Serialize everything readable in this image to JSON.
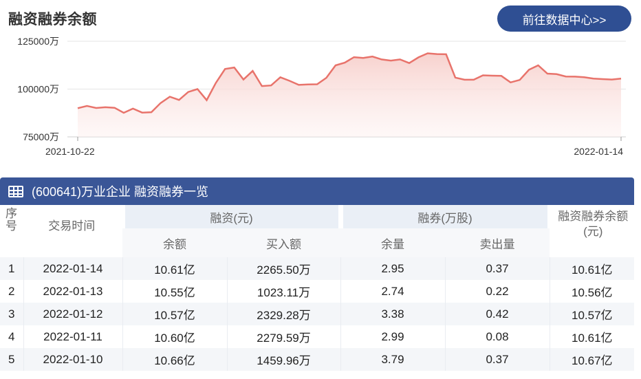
{
  "title": "融资融券余额",
  "more_button": "前往数据中心>>",
  "colors": {
    "line": "#e8736b",
    "area_top": "#f7cfcb",
    "header_bg": "#3a5697",
    "button_bg": "#2f4f93"
  },
  "chart_data": {
    "type": "area",
    "y_ticks": [
      "125000万",
      "100000万",
      "75000万"
    ],
    "y_tick_values": [
      125000,
      100000,
      75000
    ],
    "ylim": [
      75000,
      125000
    ],
    "x_tick_labels": [
      "2021-10-22",
      "2022-01-14"
    ],
    "grid": true,
    "values": [
      90000,
      91200,
      90100,
      90500,
      90200,
      87600,
      89800,
      87700,
      87900,
      92700,
      96000,
      94300,
      98500,
      100000,
      94200,
      103200,
      110500,
      111300,
      105000,
      109500,
      101600,
      101900,
      106200,
      104300,
      102200,
      102400,
      102500,
      105900,
      112400,
      113800,
      116700,
      116300,
      117000,
      115500,
      114900,
      115500,
      113600,
      116600,
      118700,
      118300,
      118200,
      106000,
      104900,
      104900,
      107200,
      107000,
      106900,
      103500,
      104800,
      110100,
      112400,
      108100,
      107800,
      106600,
      106500,
      106200,
      105500,
      105200,
      105000,
      105500
    ]
  },
  "table": {
    "header_title": "(600641)万业企业 融资融券一览",
    "col_seq": "序号",
    "col_date": "交易时间",
    "group_financing": "融资(元)",
    "group_securities": "融券(万股)",
    "col_total": "融资融券余额(元)",
    "sub_fin_balance": "余额",
    "sub_fin_buy": "买入额",
    "sub_sec_balance": "余量",
    "sub_sec_sell": "卖出量",
    "rows": [
      [
        "1",
        "2022-01-14",
        "10.61亿",
        "2265.50万",
        "2.95",
        "0.37",
        "10.61亿"
      ],
      [
        "2",
        "2022-01-13",
        "10.55亿",
        "1023.11万",
        "2.74",
        "0.22",
        "10.56亿"
      ],
      [
        "3",
        "2022-01-12",
        "10.57亿",
        "2329.28万",
        "3.38",
        "0.42",
        "10.57亿"
      ],
      [
        "4",
        "2022-01-11",
        "10.60亿",
        "2279.59万",
        "2.99",
        "0.08",
        "10.61亿"
      ],
      [
        "5",
        "2022-01-10",
        "10.66亿",
        "1459.96万",
        "3.79",
        "0.37",
        "10.67亿"
      ]
    ]
  }
}
